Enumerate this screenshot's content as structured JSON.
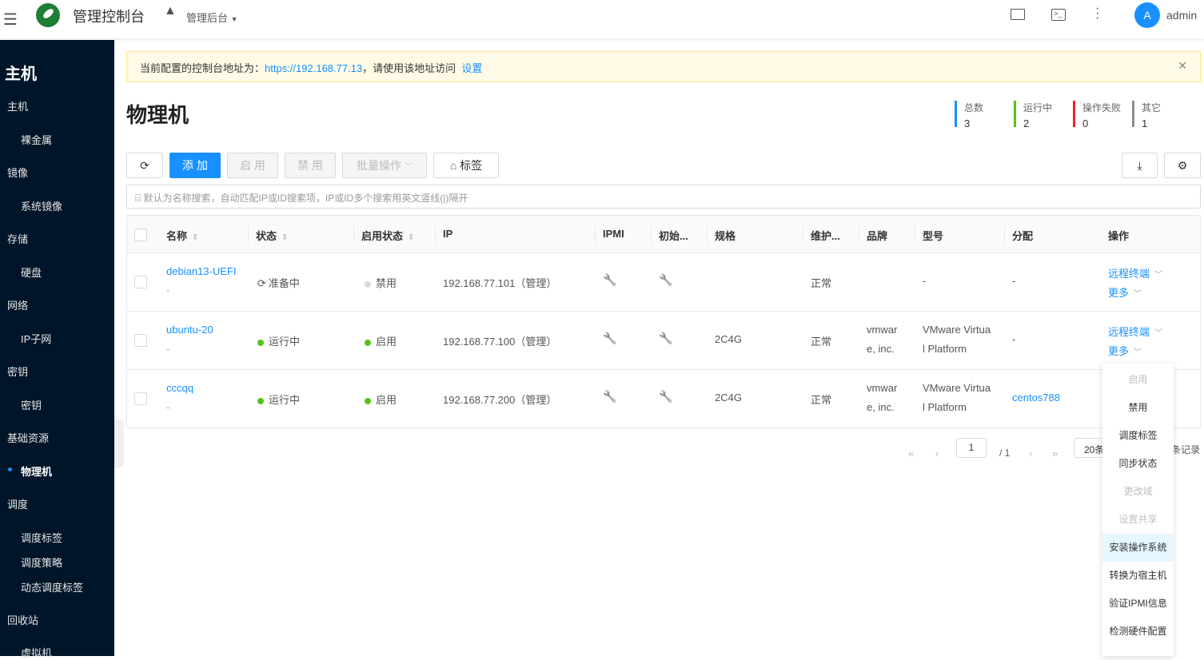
{
  "topbar": {
    "app_title": "管理控制台",
    "scope": "管理后台",
    "avatar_letter": "A",
    "user": "admin"
  },
  "sidebar": {
    "section_title": "主机",
    "items": [
      {
        "label": "主机",
        "sub": false
      },
      {
        "label": "裸金属",
        "sub": true
      },
      {
        "label": "镜像",
        "sub": false
      },
      {
        "label": "系统镜像",
        "sub": true
      },
      {
        "label": "存储",
        "sub": false
      },
      {
        "label": "硬盘",
        "sub": true
      },
      {
        "label": "网络",
        "sub": false
      },
      {
        "label": "IP子网",
        "sub": true
      },
      {
        "label": "密钥",
        "sub": false
      },
      {
        "label": "密钥",
        "sub": true
      },
      {
        "label": "基础资源",
        "sub": false
      },
      {
        "label": "物理机",
        "sub": true,
        "active": true
      },
      {
        "label": "调度",
        "sub": false
      },
      {
        "label": "调度标签",
        "sub": true
      },
      {
        "label": "调度策略",
        "sub": true
      },
      {
        "label": "动态调度标签",
        "sub": true
      },
      {
        "label": "回收站",
        "sub": false
      },
      {
        "label": "虚拟机",
        "sub": true
      }
    ]
  },
  "notice": {
    "text": "当前配置的控制台地址为：",
    "url": "https://192.168.77.13",
    "suffix": "，请使用该地址访问",
    "action": "设置"
  },
  "page_title": "物理机",
  "stats": [
    {
      "label": "总数",
      "value": "3",
      "color": "#1890ff"
    },
    {
      "label": "运行中",
      "value": "2",
      "color": "#52c41a"
    },
    {
      "label": "操作失败",
      "value": "0",
      "color": "#f5222d"
    },
    {
      "label": "其它",
      "value": "1",
      "color": "#8c8c8c"
    }
  ],
  "toolbar": {
    "add": "添 加",
    "enable": "启 用",
    "disable": "禁 用",
    "batch": "批量操作",
    "tags": "标签"
  },
  "search": {
    "placeholder": "默认为名称搜索，自动匹配IP或ID搜索项，IP或ID多个搜索用英文竖线(|)隔开"
  },
  "table": {
    "headers": [
      "名称",
      "状态",
      "启用状态",
      "IP",
      "IPMI",
      "初始...",
      "规格",
      "维护...",
      "品牌",
      "型号",
      "分配",
      "操作"
    ],
    "rows": [
      {
        "name": "debian13-UEFI",
        "sub": "-",
        "status": "准备中",
        "status_color": "",
        "enabled": "禁用",
        "enabled_color": "#d9d9d9",
        "ip": "192.168.77.101（管理）",
        "spec": "",
        "maint": "正常",
        "brand1": "-",
        "brand2": "",
        "model1": "-",
        "model2": "",
        "alloc": "-",
        "alloc_link": false,
        "op1": "远程终端",
        "op2": "更多"
      },
      {
        "name": "ubuntu-20",
        "sub": "-",
        "status": "运行中",
        "status_color": "#52c41a",
        "enabled": "启用",
        "enabled_color": "#52c41a",
        "ip": "192.168.77.100（管理）",
        "spec": "2C4G",
        "maint": "正常",
        "brand1": "vmwar",
        "brand2": "e, inc.",
        "model1": "VMware Virtua",
        "model2": "l Platform",
        "alloc": "-",
        "alloc_link": false,
        "op1": "远程终端",
        "op2": "更多"
      },
      {
        "name": "cccqq",
        "sub": "-",
        "status": "运行中",
        "status_color": "#52c41a",
        "enabled": "启用",
        "enabled_color": "#52c41a",
        "ip": "192.168.77.200（管理）",
        "spec": "2C4G",
        "maint": "正常",
        "brand1": "vmwar",
        "brand2": "e, inc.",
        "model1": "VMware Virtua",
        "model2": "l Platform",
        "alloc": "centos788",
        "alloc_link": true,
        "op1": "",
        "op2": ""
      }
    ]
  },
  "pagination": {
    "page": "1",
    "total_pages": "/ 1",
    "page_size": "20条",
    "records": "条记录"
  },
  "more_menu": [
    {
      "label": "启用",
      "disabled": true
    },
    {
      "label": "禁用"
    },
    {
      "label": "调度标签"
    },
    {
      "label": "同步状态"
    },
    {
      "label": "更改域",
      "disabled": true
    },
    {
      "label": "设置共享",
      "disabled": true
    },
    {
      "label": "安装操作系统",
      "highlight": true
    },
    {
      "label": "转换为宿主机"
    },
    {
      "label": "验证IPMI信息"
    },
    {
      "label": "检测硬件配置"
    }
  ]
}
